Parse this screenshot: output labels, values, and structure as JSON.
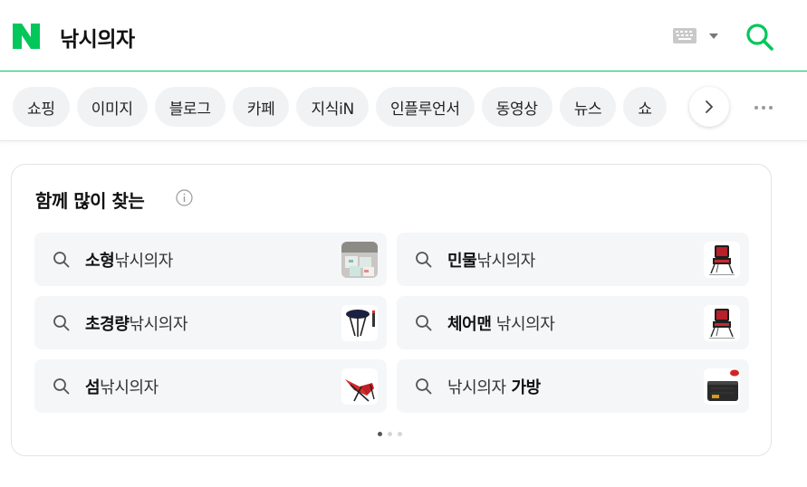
{
  "header": {
    "logo_letter": "N",
    "query": "낚시의자",
    "brand_color": "#03c75a"
  },
  "tabs": {
    "items": [
      "쇼핑",
      "이미지",
      "블로그",
      "카페",
      "지식iN",
      "인플루언서",
      "동영상",
      "뉴스",
      "쇼"
    ],
    "next_icon": "chevron-right-icon",
    "more_icon": "more-dots-icon"
  },
  "related": {
    "title": "함께 많이 찾는",
    "info_icon": "info-icon",
    "chips": [
      {
        "bold": "소형",
        "rest": "낚시의자",
        "bold_first": true,
        "thumb": "box-product"
      },
      {
        "bold": "민물",
        "rest": "낚시의자",
        "bold_first": true,
        "thumb": "red-chair"
      },
      {
        "bold": "초경량",
        "rest": "낚시의자",
        "bold_first": true,
        "thumb": "stool"
      },
      {
        "bold": "체어맨",
        "rest": " 낚시의자",
        "bold_first": true,
        "thumb": "red-chair"
      },
      {
        "bold": "섬",
        "rest": "낚시의자",
        "bold_first": true,
        "thumb": "folding-chair"
      },
      {
        "bold": " 가방",
        "rest": "낚시의자",
        "bold_first": false,
        "thumb": "bag"
      }
    ],
    "page_dots": 3,
    "active_dot": 0
  }
}
